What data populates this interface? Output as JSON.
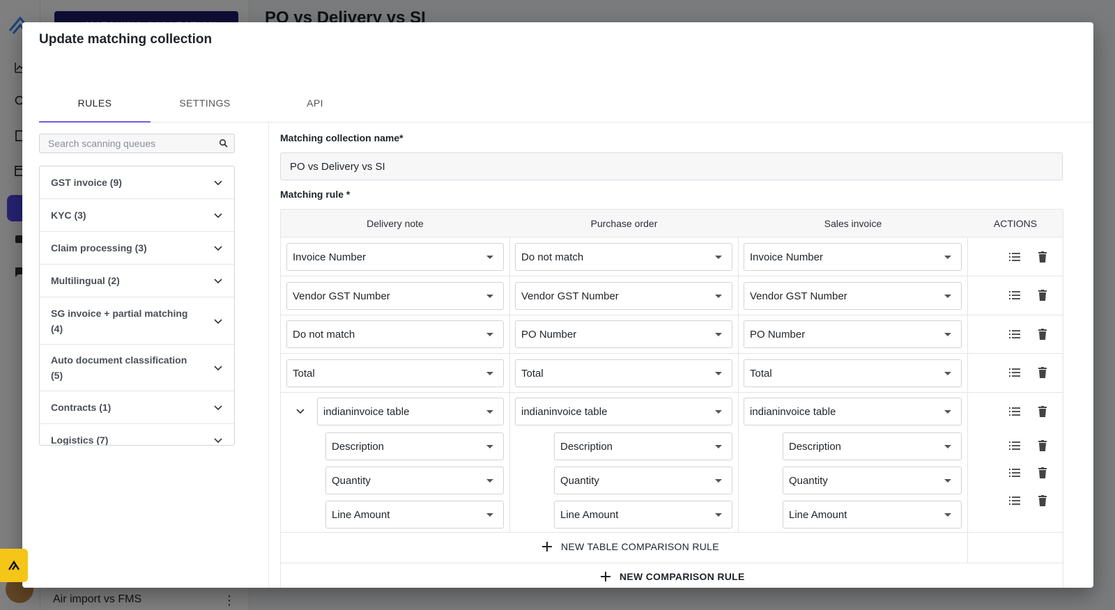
{
  "background": {
    "new_button_label": "+ MATCHING COLLECTION",
    "page_title": "PO vs Delivery vs SI",
    "list_item": "Air import vs FMS"
  },
  "modal": {
    "title": "Update matching collection",
    "tabs": [
      {
        "label": "RULES",
        "active": true
      },
      {
        "label": "SETTINGS",
        "active": false
      },
      {
        "label": "API",
        "active": false
      }
    ],
    "search": {
      "placeholder": "Search scanning queues",
      "value": ""
    },
    "queues": [
      "GST invoice (9)",
      "KYC (3)",
      "Claim processing (3)",
      "Multilingual (2)",
      "SG invoice + partial matching (4)",
      "Auto document classification (5)",
      "Contracts (1)",
      "Logistics (7)"
    ],
    "collection_name_label": "Matching collection name*",
    "collection_name_value": "PO vs Delivery vs SI",
    "matching_rule_label": "Matching rule *",
    "columns": [
      "Delivery note",
      "Purchase order",
      "Sales invoice",
      "ACTIONS"
    ],
    "rules": [
      {
        "delivery": "Invoice Number",
        "purchase": "Do not match",
        "sales": "Invoice Number"
      },
      {
        "delivery": "Vendor GST Number",
        "purchase": "Vendor GST Number",
        "sales": "Vendor GST Number"
      },
      {
        "delivery": "Do not match",
        "purchase": "PO Number",
        "sales": "PO Number"
      },
      {
        "delivery": "Total",
        "purchase": "Total",
        "sales": "Total"
      }
    ],
    "table_rule": {
      "delivery": "indianinvoice table",
      "purchase": "indianinvoice table",
      "sales": "indianinvoice table",
      "columns": [
        {
          "delivery": "Description",
          "purchase": "Description",
          "sales": "Description"
        },
        {
          "delivery": "Quantity",
          "purchase": "Quantity",
          "sales": "Quantity"
        },
        {
          "delivery": "Line Amount",
          "purchase": "Line Amount",
          "sales": "Line Amount"
        }
      ]
    },
    "new_table_rule_label": "NEW TABLE COMPARISON RULE",
    "new_rule_label": "NEW COMPARISON RULE"
  },
  "colors": {
    "accent": "#6d5ce7",
    "brand": "#1e1b6b",
    "fab": "#f5c518"
  }
}
